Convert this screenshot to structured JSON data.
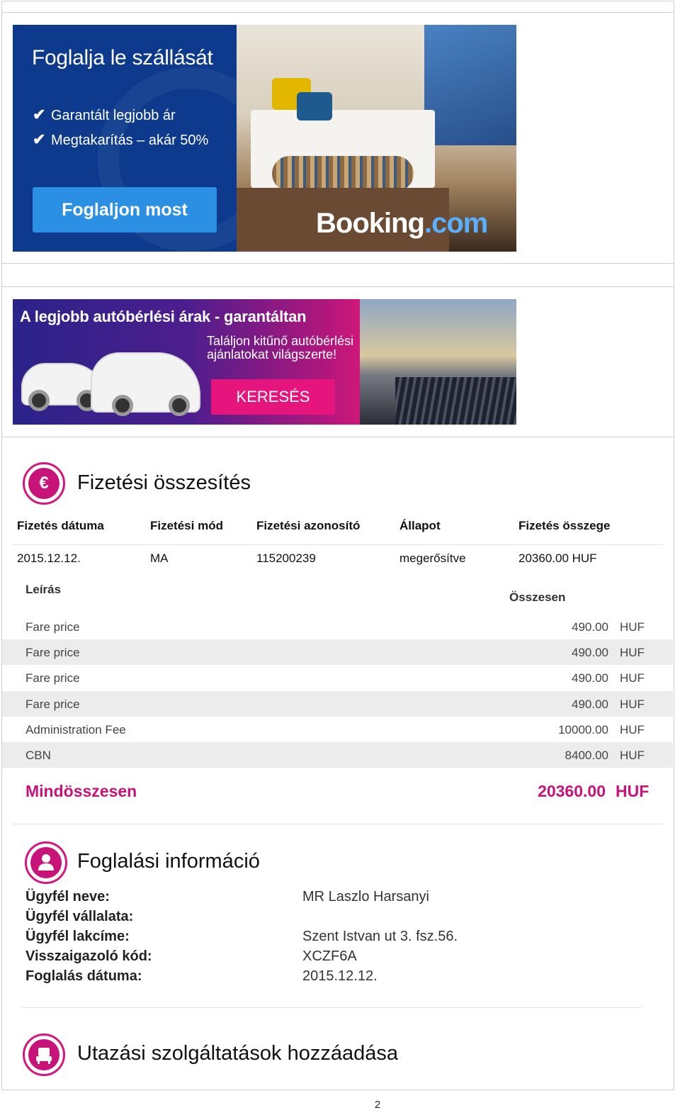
{
  "banner_hotel": {
    "title": "Foglalja le szállását",
    "bullets": [
      "Garantált legjobb ár",
      "Megtakarítás – akár 50%"
    ],
    "cta": "Foglaljon most",
    "brand_main": "Booking",
    "brand_tld": ".com",
    "tick": "✔"
  },
  "banner_car": {
    "headline": "A legjobb autóbérlési árak - garantáltan",
    "subtext": "Találjon kitűnő autóbérlési ajánlatokat világszerte!",
    "cta": "KERESÉS"
  },
  "payment": {
    "icon_glyph": "€",
    "title": "Fizetési összesítés",
    "headers": {
      "date": "Fizetés dátuma",
      "method": "Fizetési mód",
      "id": "Fizetési azonosító",
      "status": "Állapot",
      "amount": "Fizetés összege"
    },
    "row": {
      "date": "2015.12.12.",
      "method": "MA",
      "id": "115200239",
      "status": "megerősítve",
      "amount": "20360.00  HUF"
    },
    "desc_header": "Leírás",
    "total_header": "Összesen",
    "lines": [
      {
        "desc": "Fare price",
        "amount": "490.00",
        "currency": "HUF"
      },
      {
        "desc": "Fare price",
        "amount": "490.00",
        "currency": "HUF"
      },
      {
        "desc": "Fare price",
        "amount": "490.00",
        "currency": "HUF"
      },
      {
        "desc": "Fare price",
        "amount": "490.00",
        "currency": "HUF"
      },
      {
        "desc": "Administration Fee",
        "amount": "10000.00",
        "currency": "HUF"
      },
      {
        "desc": "CBN",
        "amount": "8400.00",
        "currency": "HUF"
      }
    ],
    "grand_total_label": "Mindösszesen",
    "grand_total_amount": "20360.00",
    "grand_total_currency": "HUF"
  },
  "booking_info": {
    "title": "Foglalási információ",
    "fields": [
      {
        "label": "Ügyfél neve:",
        "value": "MR  Laszlo  Harsanyi"
      },
      {
        "label": "Ügyfél vállalata:",
        "value": ""
      },
      {
        "label": "Ügyfél lakcíme:",
        "value": "Szent Istvan ut 3. fsz.56."
      },
      {
        "label": "Visszaigazoló kód:",
        "value": "XCZF6A"
      },
      {
        "label": "Foglalás dátuma:",
        "value": "2015.12.12."
      }
    ]
  },
  "services": {
    "title": "Utazási szolgáltatások hozzáadása"
  },
  "page_number": "2",
  "colors": {
    "accent": "#c81379",
    "booking_blue": "#0d3a8c",
    "row_alt": "#ececec"
  }
}
